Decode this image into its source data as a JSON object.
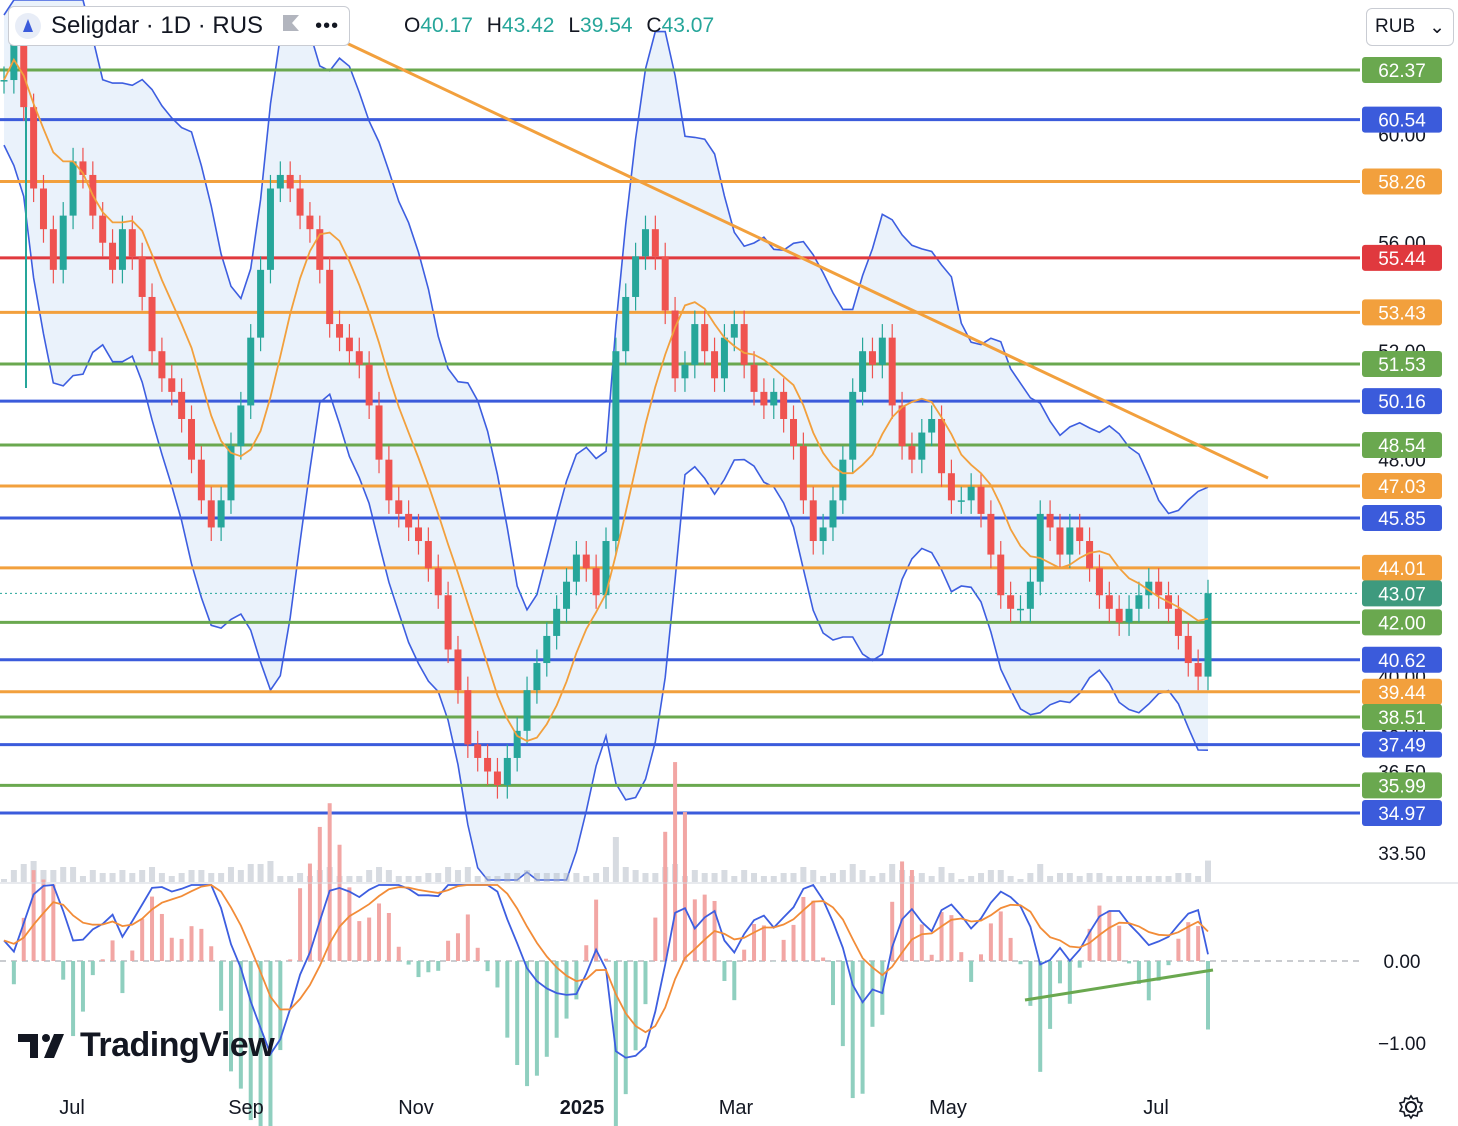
{
  "header": {
    "symbol": "Seligdar · 1D · RUS",
    "more_label": "•••"
  },
  "ohlc": {
    "o_label": "O",
    "o": "40.17",
    "h_label": "H",
    "h": "43.42",
    "l_label": "L",
    "l": "39.54",
    "c_label": "C",
    "c": "43.07"
  },
  "currency": {
    "label": "RUB"
  },
  "brand": {
    "name": "TradingView"
  },
  "colors": {
    "up": "#26a69a",
    "down": "#ef5350",
    "blue": "#3b5bdb",
    "green": "#6aa84f",
    "orange": "#f2a03d",
    "red": "#e0393e",
    "bb_fill": "#eaf2fb",
    "bb_line": "#3d5ee0"
  },
  "chart_data": {
    "type": "candlestick",
    "x_ticks": [
      "Jul",
      "Sep",
      "Nov",
      "2025",
      "Mar",
      "May",
      "Jul"
    ],
    "price_axis_ticks": [
      "60.00",
      "56.00",
      "52.00",
      "48.00",
      "40.00",
      "38.00",
      "36.50",
      "33.50"
    ],
    "price_range": [
      33.0,
      65.0
    ],
    "last_price": 43.07,
    "ohlc": {
      "open": 40.17,
      "high": 43.42,
      "low": 39.54,
      "close": 43.07
    },
    "horizontal_levels": [
      {
        "price": 62.37,
        "label": "62.37",
        "color": "green"
      },
      {
        "price": 60.54,
        "label": "60.54",
        "color": "blue"
      },
      {
        "price": 58.26,
        "label": "58.26",
        "color": "orange"
      },
      {
        "price": 55.44,
        "label": "55.44",
        "color": "red"
      },
      {
        "price": 53.43,
        "label": "53.43",
        "color": "orange"
      },
      {
        "price": 51.53,
        "label": "51.53",
        "color": "green"
      },
      {
        "price": 50.16,
        "label": "50.16",
        "color": "blue"
      },
      {
        "price": 48.54,
        "label": "48.54",
        "color": "green"
      },
      {
        "price": 47.03,
        "label": "47.03",
        "color": "orange"
      },
      {
        "price": 45.85,
        "label": "45.85",
        "color": "blue"
      },
      {
        "price": 44.01,
        "label": "44.01",
        "color": "orange"
      },
      {
        "price": 43.07,
        "label": "43.07",
        "color": "last"
      },
      {
        "price": 42.0,
        "label": "42.00",
        "color": "green"
      },
      {
        "price": 40.62,
        "label": "40.62",
        "color": "blue"
      },
      {
        "price": 39.44,
        "label": "39.44",
        "color": "orange"
      },
      {
        "price": 38.51,
        "label": "38.51",
        "color": "green"
      },
      {
        "price": 37.49,
        "label": "37.49",
        "color": "blue"
      },
      {
        "price": 35.99,
        "label": "35.99",
        "color": "green"
      },
      {
        "price": 34.97,
        "label": "34.97",
        "color": "blue"
      }
    ],
    "close_series": [
      62.0,
      63.5,
      61.0,
      58.0,
      56.5,
      55.0,
      57.0,
      59.0,
      58.5,
      57.0,
      56.0,
      55.0,
      56.5,
      55.5,
      54.0,
      52.0,
      51.0,
      50.5,
      49.5,
      48.0,
      46.5,
      45.5,
      46.5,
      48.5,
      50.0,
      52.5,
      55.0,
      58.0,
      58.5,
      58.0,
      57.0,
      56.5,
      55.0,
      53.0,
      52.5,
      52.0,
      51.5,
      50.0,
      48.0,
      46.5,
      46.0,
      45.5,
      45.0,
      44.0,
      43.0,
      41.0,
      39.5,
      37.5,
      37.0,
      36.5,
      36.0,
      37.0,
      38.0,
      39.5,
      40.5,
      41.5,
      42.5,
      43.5,
      44.5,
      44.0,
      43.0,
      45.0,
      52.0,
      54.0,
      55.5,
      56.5,
      55.5,
      53.5,
      51.0,
      51.5,
      53.0,
      52.0,
      51.0,
      52.5,
      53.0,
      51.5,
      50.5,
      50.0,
      50.5,
      49.5,
      48.5,
      46.5,
      45.0,
      45.5,
      46.5,
      48.0,
      50.5,
      52.0,
      51.5,
      52.5,
      50.0,
      48.5,
      48.0,
      49.0,
      49.5,
      47.5,
      46.5,
      46.5,
      47.0,
      46.0,
      44.5,
      43.0,
      42.5,
      42.5,
      43.5,
      46.0,
      45.5,
      44.5,
      45.5,
      45.0,
      44.0,
      43.0,
      42.5,
      42.0,
      42.5,
      43.0,
      43.5,
      43.0,
      42.5,
      41.5,
      40.5,
      40.0,
      43.07
    ],
    "volume_note": "volume bars shown faint along bottom of price pane",
    "indicators": {
      "bollinger_bands": true,
      "moving_average": "orange",
      "macd": {
        "zero_label": "0.00",
        "minus_one_label": "−1.00",
        "zero": 0.0,
        "minus_one": -1.0
      }
    }
  }
}
